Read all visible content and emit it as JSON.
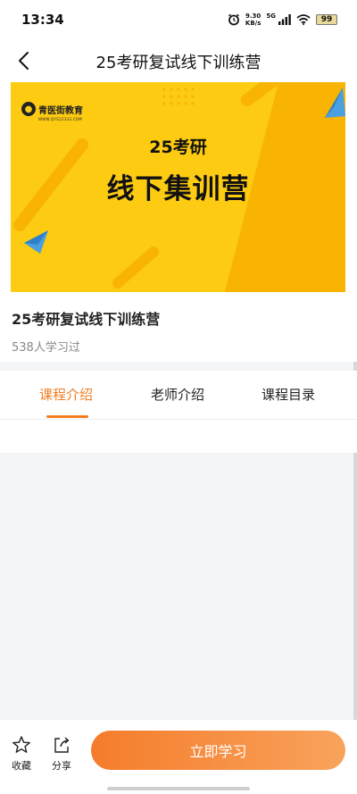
{
  "status_bar": {
    "time": "13:34",
    "net_speed": "9.30",
    "net_unit": "KB/s",
    "network": "5G",
    "battery": "99"
  },
  "nav": {
    "title": "25考研复试线下训练营"
  },
  "banner": {
    "logo_text": "青医街教育",
    "logo_url": "WWW.QYS12333.COM",
    "line1": "25考研",
    "line2": "线下集训营",
    "bg_color": "#fccb12"
  },
  "course": {
    "title": "25考研复试线下训练营",
    "learners": "538人学习过"
  },
  "tabs": [
    {
      "label": "课程介绍"
    },
    {
      "label": "老师介绍"
    },
    {
      "label": "课程目录"
    }
  ],
  "bottom": {
    "favorite_label": "收藏",
    "share_label": "分享",
    "study_label": "立即学习",
    "accent_color": "#f07d22"
  }
}
